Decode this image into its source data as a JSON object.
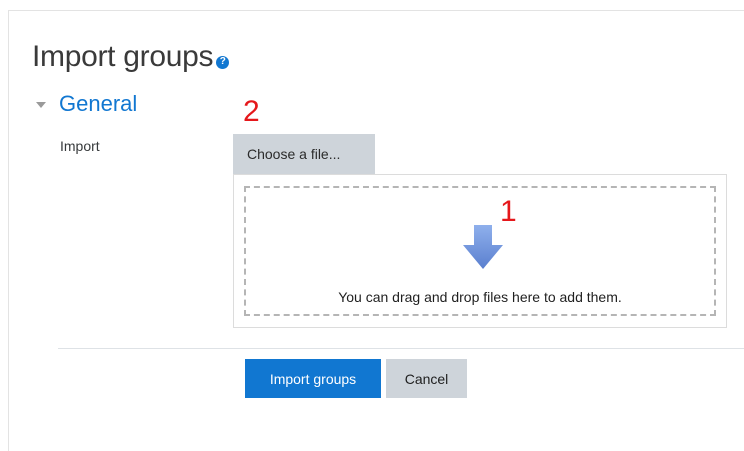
{
  "page": {
    "title": "Import groups",
    "help_icon_glyph": "?"
  },
  "section": {
    "title": "General",
    "expanded": true
  },
  "form": {
    "import_label": "Import",
    "choose_file_label": "Choose a file...",
    "dropzone_text": "You can drag and drop files here to add them."
  },
  "annotations": {
    "step_one": "1",
    "step_two": "2",
    "color": "#e5171b"
  },
  "buttons": {
    "submit_label": "Import groups",
    "cancel_label": "Cancel"
  },
  "colors": {
    "accent": "#1177d1",
    "secondary_button": "#ced4da",
    "arrow": "#6c8fd8"
  },
  "icons": {
    "help": "question-circle-icon",
    "collapse": "triangle-down-icon",
    "drop": "arrow-down-icon"
  }
}
